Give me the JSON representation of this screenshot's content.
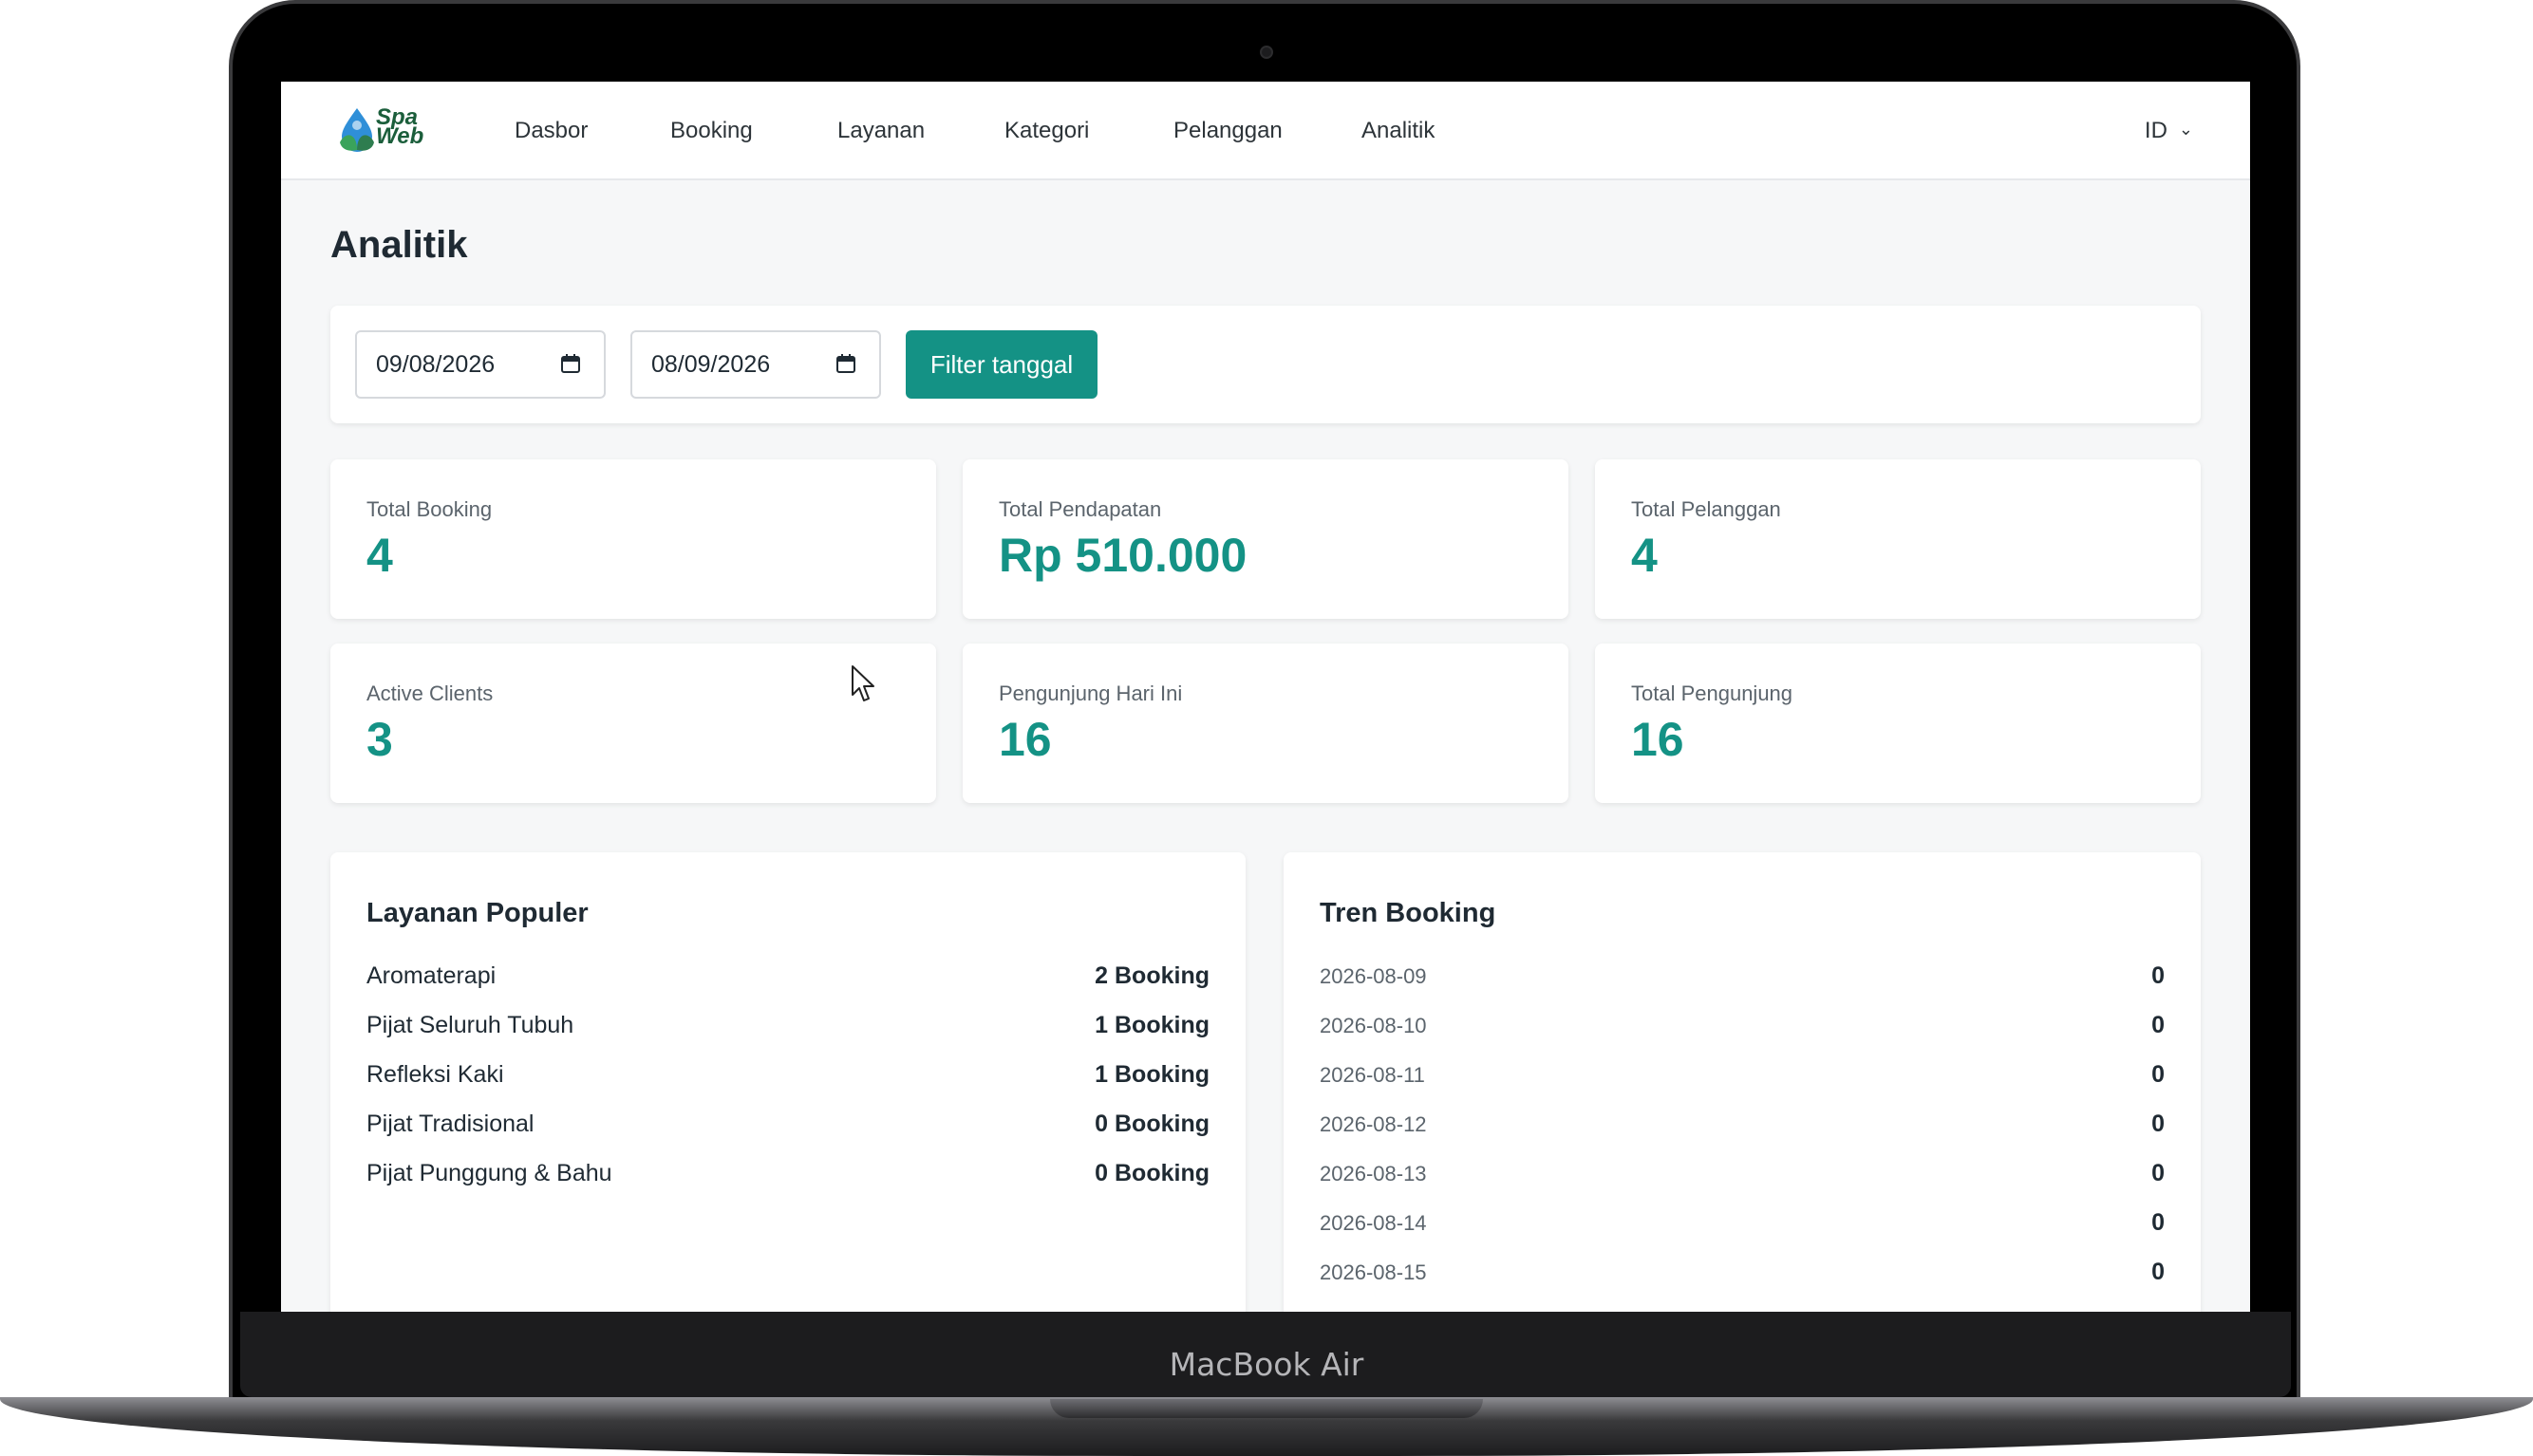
{
  "device": {
    "label": "MacBook Air"
  },
  "logo": {
    "line1": "Spa",
    "line2": "Web"
  },
  "nav": {
    "items": [
      "Dasbor",
      "Booking",
      "Layanan",
      "Kategori",
      "Pelanggan",
      "Analitik"
    ],
    "language": "ID"
  },
  "page": {
    "title": "Analitik"
  },
  "filter": {
    "start_date": "09/08/2026",
    "end_date": "08/09/2026",
    "button_label": "Filter tanggal"
  },
  "stats": [
    {
      "label": "Total Booking",
      "value": "4"
    },
    {
      "label": "Total Pendapatan",
      "value": "Rp 510.000"
    },
    {
      "label": "Total Pelanggan",
      "value": "4"
    },
    {
      "label": "Active Clients",
      "value": "3"
    },
    {
      "label": "Pengunjung Hari Ini",
      "value": "16"
    },
    {
      "label": "Total Pengunjung",
      "value": "16"
    }
  ],
  "popular_services": {
    "title": "Layanan Populer",
    "rows": [
      {
        "name": "Aromaterapi",
        "value": "2 Booking"
      },
      {
        "name": "Pijat Seluruh Tubuh",
        "value": "1 Booking"
      },
      {
        "name": "Refleksi Kaki",
        "value": "1 Booking"
      },
      {
        "name": "Pijat Tradisional",
        "value": "0 Booking"
      },
      {
        "name": "Pijat Punggung & Bahu",
        "value": "0 Booking"
      }
    ]
  },
  "booking_trend": {
    "title": "Tren Booking",
    "rows": [
      {
        "date": "2026-08-09",
        "value": "0"
      },
      {
        "date": "2026-08-10",
        "value": "0"
      },
      {
        "date": "2026-08-11",
        "value": "0"
      },
      {
        "date": "2026-08-12",
        "value": "0"
      },
      {
        "date": "2026-08-13",
        "value": "0"
      },
      {
        "date": "2026-08-14",
        "value": "0"
      },
      {
        "date": "2026-08-15",
        "value": "0"
      }
    ]
  },
  "colors": {
    "accent": "#149285",
    "text": "#1f2a33",
    "muted": "#5b646c",
    "background": "#f6f7f8"
  }
}
